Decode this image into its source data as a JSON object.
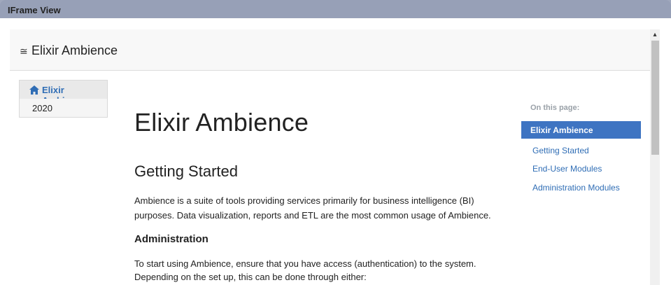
{
  "window": {
    "title": "IFrame View"
  },
  "header": {
    "menu_icon": "≅",
    "brand": "Elixir Ambience"
  },
  "leftnav": {
    "items": [
      {
        "label": "Elixir Ambience",
        "icon": "home-icon"
      },
      {
        "label": "2020"
      }
    ]
  },
  "content": {
    "title": "Elixir Ambience",
    "section_title": "Getting Started",
    "intro": "Ambience is a suite of tools providing services primarily for business intelligence (BI) purposes. Data visualization, reports and ETL are the most common usage of Ambience.",
    "admin_title": "Administration",
    "admin_text": "To start using Ambience, ensure that you have access (authentication) to the system. Depending on the set up, this can be done through either:"
  },
  "toc": {
    "title": "On this page:",
    "items": [
      "Elixir Ambience",
      "Getting Started",
      "End-User Modules",
      "Administration Modules"
    ]
  },
  "colors": {
    "accent": "#3e74c2",
    "link": "#2f6db5",
    "titlebar": "#97a0b7"
  }
}
